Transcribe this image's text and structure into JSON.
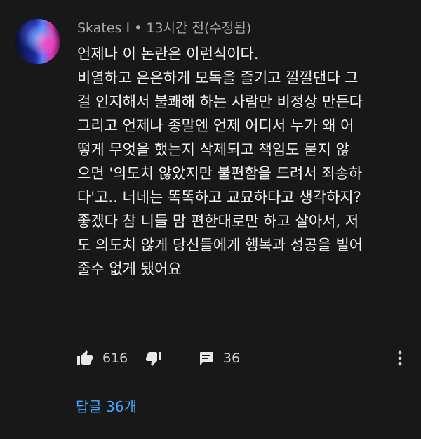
{
  "comment": {
    "author": "Skates I",
    "separator": "•",
    "time": "13시간 전(수정됨)",
    "lines": [
      "언제나 이 논란은 이런식이다.",
      "비열하고 은은하게 모독을 즐기고 낄낄댄다 그",
      "걸 인지해서 불쾌해 하는 사람만 비정상 만든다",
      "그리고 언제나 종말엔 언제 어디서 누가 왜 어",
      "떻게 무엇을 했는지 삭제되고 책임도 묻지 않",
      "으면 '의도치 않았지만 불편함을 드려서 죄송하",
      "다'고.. 너네는 똑똑하고 교묘하다고 생각하지?",
      "좋겠다 참 니들 맘 편한대로만 하고 살아서, 저",
      "도 의도치 않게 당신들에게 행복과 성공을 빌어",
      "줄수 없게 됐어요"
    ]
  },
  "actions": {
    "like_icon": "thumbs-up-icon",
    "like_count": "616",
    "dislike_icon": "thumbs-down-icon",
    "reply_icon": "comment-icon",
    "reply_count": "36",
    "more_icon": "more-vertical-icon"
  },
  "replies_label": "답글 36개",
  "colors": {
    "background": "#181818",
    "text": "#f1f1f1",
    "meta": "#aaaaaa",
    "link": "#3ea6ff"
  }
}
